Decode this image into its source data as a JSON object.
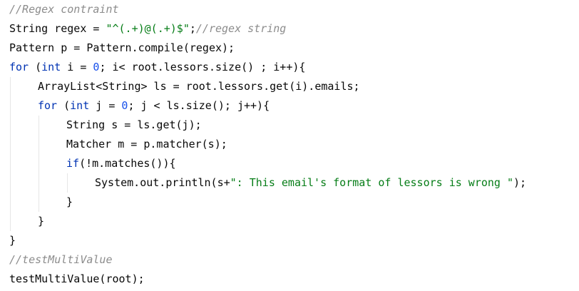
{
  "code": {
    "lines": [
      {
        "indent": 0,
        "tokens": [
          {
            "c": "cm",
            "t": "//Regex contraint"
          }
        ]
      },
      {
        "indent": 0,
        "tokens": [
          {
            "c": "",
            "t": "String regex = "
          },
          {
            "c": "st",
            "t": "\"^(.+)@(.+)$\""
          },
          {
            "c": "",
            "t": ";"
          },
          {
            "c": "cm",
            "t": "//regex string"
          }
        ]
      },
      {
        "indent": 0,
        "tokens": [
          {
            "c": "",
            "t": "Pattern p = Pattern.compile(regex);"
          }
        ]
      },
      {
        "indent": 0,
        "tokens": [
          {
            "c": "kw",
            "t": "for"
          },
          {
            "c": "",
            "t": " ("
          },
          {
            "c": "kw",
            "t": "int"
          },
          {
            "c": "",
            "t": " i = "
          },
          {
            "c": "nm",
            "t": "0"
          },
          {
            "c": "",
            "t": "; i< root.lessors.size() ; i++){"
          }
        ]
      },
      {
        "indent": 1,
        "tokens": [
          {
            "c": "",
            "t": "ArrayList<String> ls = root.lessors.get(i).emails;"
          }
        ]
      },
      {
        "indent": 1,
        "tokens": [
          {
            "c": "kw",
            "t": "for"
          },
          {
            "c": "",
            "t": " ("
          },
          {
            "c": "kw",
            "t": "int"
          },
          {
            "c": "",
            "t": " j = "
          },
          {
            "c": "nm",
            "t": "0"
          },
          {
            "c": "",
            "t": "; j < ls.size(); j++){"
          }
        ]
      },
      {
        "indent": 2,
        "tokens": [
          {
            "c": "",
            "t": "String s = ls.get(j);"
          }
        ]
      },
      {
        "indent": 2,
        "tokens": [
          {
            "c": "",
            "t": "Matcher m = p.matcher(s);"
          }
        ]
      },
      {
        "indent": 2,
        "tokens": [
          {
            "c": "kw",
            "t": "if"
          },
          {
            "c": "",
            "t": "(!m.matches()){"
          }
        ]
      },
      {
        "indent": 3,
        "tokens": [
          {
            "c": "",
            "t": "System.out.println(s+"
          },
          {
            "c": "st",
            "t": "\": This email's format of lessors is wrong \""
          },
          {
            "c": "",
            "t": ");"
          }
        ]
      },
      {
        "indent": 2,
        "tokens": [
          {
            "c": "",
            "t": "}"
          }
        ]
      },
      {
        "indent": 1,
        "tokens": [
          {
            "c": "",
            "t": "}"
          }
        ]
      },
      {
        "indent": 0,
        "tokens": [
          {
            "c": "",
            "t": "}"
          }
        ]
      },
      {
        "indent": 0,
        "tokens": [
          {
            "c": "cm",
            "t": "//testMultiValue"
          }
        ]
      },
      {
        "indent": 0,
        "tokens": [
          {
            "c": "",
            "t": "testMultiValue(root);"
          }
        ]
      }
    ]
  },
  "colors": {
    "background": "#ffffff",
    "text": "#080808",
    "comment": "#8c8c8c",
    "keyword": "#0033b3",
    "string": "#067d17",
    "number": "#1750eb",
    "indent_guide": "#e6e6e6"
  }
}
